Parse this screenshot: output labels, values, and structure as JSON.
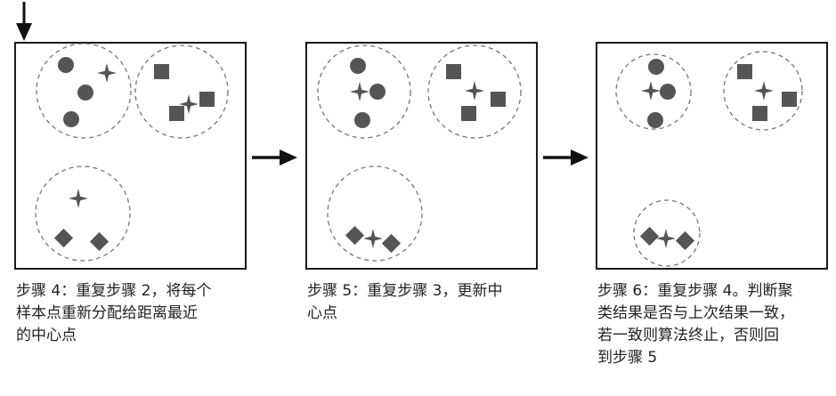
{
  "colors": {
    "frame": "#000000",
    "marker": "#555555",
    "cluster_outline": "#777777",
    "arrow": "#111111",
    "caption_text": "#222222"
  },
  "panels": [
    {
      "id": "step4",
      "clusters": [
        {
          "markers": [
            "circle",
            "circle",
            "circle"
          ],
          "centroid": "star-icon"
        },
        {
          "markers": [
            "square",
            "square",
            "square"
          ],
          "centroid": "star-icon"
        },
        {
          "markers": [
            "diamond",
            "diamond"
          ],
          "centroid": "star-icon"
        }
      ],
      "caption_lines": [
        "步骤 4：重复步骤 2，将每个",
        "样本点重新分配给距离最近",
        "的中心点"
      ]
    },
    {
      "id": "step5",
      "clusters": [
        {
          "markers": [
            "circle",
            "circle",
            "circle"
          ],
          "centroid": "star-icon"
        },
        {
          "markers": [
            "square",
            "square",
            "square"
          ],
          "centroid": "star-icon"
        },
        {
          "markers": [
            "diamond",
            "diamond"
          ],
          "centroid": "star-icon"
        }
      ],
      "caption_lines": [
        "步骤 5：重复步骤 3，更新中",
        "心点"
      ]
    },
    {
      "id": "step6",
      "clusters": [
        {
          "markers": [
            "circle",
            "circle",
            "circle"
          ],
          "centroid": "star-icon"
        },
        {
          "markers": [
            "square",
            "square",
            "square"
          ],
          "centroid": "star-icon"
        },
        {
          "markers": [
            "diamond",
            "diamond"
          ],
          "centroid": "star-icon"
        }
      ],
      "caption_lines": [
        "步骤 6：重复步骤 4。判断聚",
        "类结果是否与上次结果一致，",
        "若一致则算法终止，否则回",
        "到步骤 5"
      ]
    }
  ],
  "icons": [
    "down-arrow-icon",
    "right-arrow-icon",
    "star-icon"
  ]
}
